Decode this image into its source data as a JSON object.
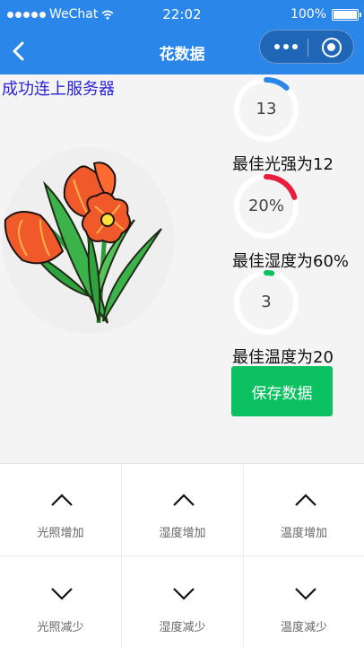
{
  "status_bar": {
    "carrier": "WeChat",
    "time": "22:02",
    "battery": "100%"
  },
  "nav": {
    "title": "花数据"
  },
  "connection_status": "成功连上服务器",
  "gauges": [
    {
      "value": "13",
      "fraction": 0.12,
      "color": "#2a86e8",
      "best_label": "最佳光强为12"
    },
    {
      "value": "20%",
      "fraction": 0.2,
      "color": "#e81e3c",
      "best_label": "最佳湿度为60%"
    },
    {
      "value": "3",
      "fraction": 0.03,
      "color": "#0bc160",
      "best_label": "最佳温度为20"
    }
  ],
  "save_button": "保存数据",
  "controls": [
    {
      "label": "光照增加",
      "direction": "up",
      "icon": "chevron-up-icon"
    },
    {
      "label": "湿度增加",
      "direction": "up",
      "icon": "chevron-up-icon"
    },
    {
      "label": "温度增加",
      "direction": "up",
      "icon": "chevron-up-icon"
    },
    {
      "label": "光照减少",
      "direction": "down",
      "icon": "chevron-down-icon"
    },
    {
      "label": "湿度减少",
      "direction": "down",
      "icon": "chevron-down-icon"
    },
    {
      "label": "温度减少",
      "direction": "down",
      "icon": "chevron-down-icon"
    }
  ],
  "icons": {
    "back": "back-arrow-icon",
    "more": "more-dots-icon",
    "close": "close-target-icon",
    "flower": "flower-image"
  }
}
